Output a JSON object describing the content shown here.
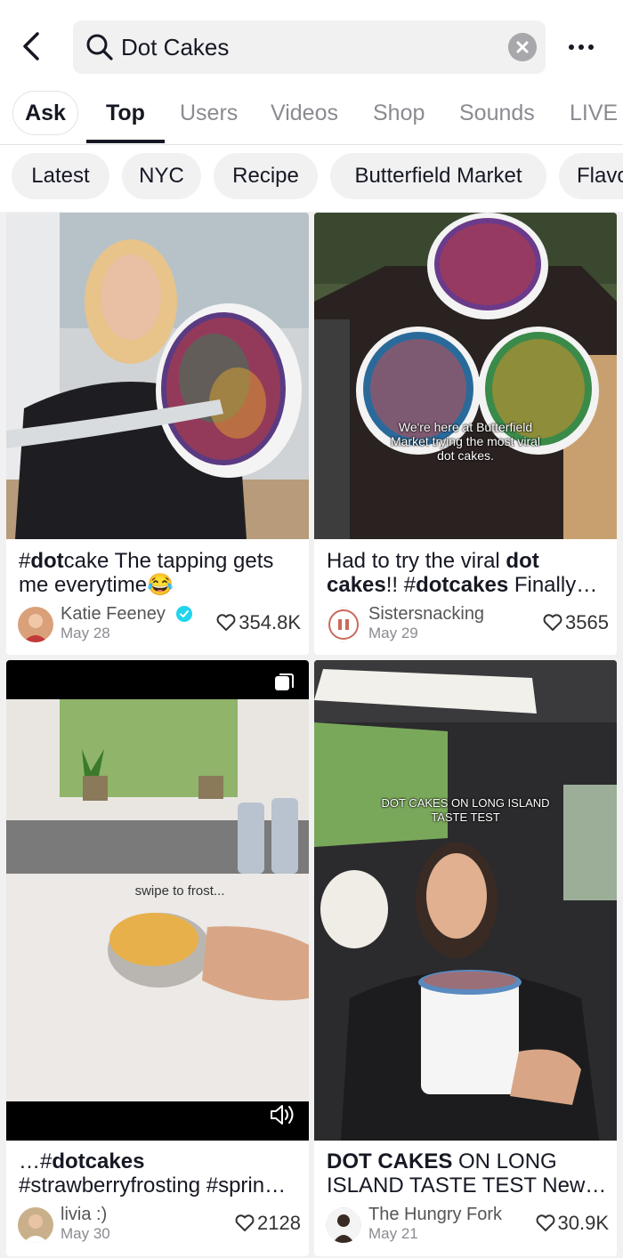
{
  "search": {
    "query": "Dot Cakes"
  },
  "tabs": [
    "Ask",
    "Top",
    "Users",
    "Videos",
    "Shop",
    "Sounds",
    "LIVE"
  ],
  "chips": [
    "Latest",
    "NYC",
    "Recipe",
    "Butterfield Market",
    "Flavo"
  ],
  "cards": [
    {
      "caption_parts": [
        "#",
        "dot",
        "cake The tapping gets me everytime😂"
      ],
      "author": "Katie Feeney",
      "verified": true,
      "date": "May 28",
      "likes": "354.8K"
    },
    {
      "caption_parts": [
        "Had to try the viral ",
        "dot cakes",
        "!! #",
        "dotcakes",
        " Finally…"
      ],
      "overlay": "We're here at Butterfield Market trying the most viral dot cakes.",
      "author": "Sistersnacking",
      "date": "May 29",
      "likes": "3565"
    },
    {
      "caption_parts": [
        "…#",
        "dotcakes",
        " #strawberryfrosting #sprin…"
      ],
      "overlay": "swipe to frost...",
      "author": "livia :)",
      "date": "May 30",
      "likes": "2128"
    },
    {
      "caption_parts": [
        "DOT CAKES",
        " ON LONG ISLAND TASTE TEST New…"
      ],
      "overlay": "DOT CAKES ON LONG ISLAND TASTE TEST",
      "author": "The Hungry Fork",
      "date": "May 21",
      "likes": "30.9K"
    }
  ],
  "colors": {
    "accent": "#161823",
    "verified": "#20d5ec",
    "muted": "#8a8b91"
  }
}
